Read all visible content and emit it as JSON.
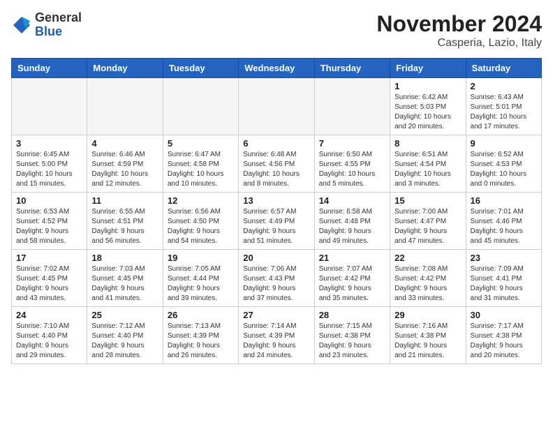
{
  "header": {
    "logo": {
      "general": "General",
      "blue": "Blue"
    },
    "title": "November 2024",
    "location": "Casperia, Lazio, Italy"
  },
  "weekdays": [
    "Sunday",
    "Monday",
    "Tuesday",
    "Wednesday",
    "Thursday",
    "Friday",
    "Saturday"
  ],
  "weeks": [
    [
      {
        "day": "",
        "info": ""
      },
      {
        "day": "",
        "info": ""
      },
      {
        "day": "",
        "info": ""
      },
      {
        "day": "",
        "info": ""
      },
      {
        "day": "",
        "info": ""
      },
      {
        "day": "1",
        "info": "Sunrise: 6:42 AM\nSunset: 5:03 PM\nDaylight: 10 hours\nand 20 minutes."
      },
      {
        "day": "2",
        "info": "Sunrise: 6:43 AM\nSunset: 5:01 PM\nDaylight: 10 hours\nand 17 minutes."
      }
    ],
    [
      {
        "day": "3",
        "info": "Sunrise: 6:45 AM\nSunset: 5:00 PM\nDaylight: 10 hours\nand 15 minutes."
      },
      {
        "day": "4",
        "info": "Sunrise: 6:46 AM\nSunset: 4:59 PM\nDaylight: 10 hours\nand 12 minutes."
      },
      {
        "day": "5",
        "info": "Sunrise: 6:47 AM\nSunset: 4:58 PM\nDaylight: 10 hours\nand 10 minutes."
      },
      {
        "day": "6",
        "info": "Sunrise: 6:48 AM\nSunset: 4:56 PM\nDaylight: 10 hours\nand 8 minutes."
      },
      {
        "day": "7",
        "info": "Sunrise: 6:50 AM\nSunset: 4:55 PM\nDaylight: 10 hours\nand 5 minutes."
      },
      {
        "day": "8",
        "info": "Sunrise: 6:51 AM\nSunset: 4:54 PM\nDaylight: 10 hours\nand 3 minutes."
      },
      {
        "day": "9",
        "info": "Sunrise: 6:52 AM\nSunset: 4:53 PM\nDaylight: 10 hours\nand 0 minutes."
      }
    ],
    [
      {
        "day": "10",
        "info": "Sunrise: 6:53 AM\nSunset: 4:52 PM\nDaylight: 9 hours\nand 58 minutes."
      },
      {
        "day": "11",
        "info": "Sunrise: 6:55 AM\nSunset: 4:51 PM\nDaylight: 9 hours\nand 56 minutes."
      },
      {
        "day": "12",
        "info": "Sunrise: 6:56 AM\nSunset: 4:50 PM\nDaylight: 9 hours\nand 54 minutes."
      },
      {
        "day": "13",
        "info": "Sunrise: 6:57 AM\nSunset: 4:49 PM\nDaylight: 9 hours\nand 51 minutes."
      },
      {
        "day": "14",
        "info": "Sunrise: 6:58 AM\nSunset: 4:48 PM\nDaylight: 9 hours\nand 49 minutes."
      },
      {
        "day": "15",
        "info": "Sunrise: 7:00 AM\nSunset: 4:47 PM\nDaylight: 9 hours\nand 47 minutes."
      },
      {
        "day": "16",
        "info": "Sunrise: 7:01 AM\nSunset: 4:46 PM\nDaylight: 9 hours\nand 45 minutes."
      }
    ],
    [
      {
        "day": "17",
        "info": "Sunrise: 7:02 AM\nSunset: 4:45 PM\nDaylight: 9 hours\nand 43 minutes."
      },
      {
        "day": "18",
        "info": "Sunrise: 7:03 AM\nSunset: 4:45 PM\nDaylight: 9 hours\nand 41 minutes."
      },
      {
        "day": "19",
        "info": "Sunrise: 7:05 AM\nSunset: 4:44 PM\nDaylight: 9 hours\nand 39 minutes."
      },
      {
        "day": "20",
        "info": "Sunrise: 7:06 AM\nSunset: 4:43 PM\nDaylight: 9 hours\nand 37 minutes."
      },
      {
        "day": "21",
        "info": "Sunrise: 7:07 AM\nSunset: 4:42 PM\nDaylight: 9 hours\nand 35 minutes."
      },
      {
        "day": "22",
        "info": "Sunrise: 7:08 AM\nSunset: 4:42 PM\nDaylight: 9 hours\nand 33 minutes."
      },
      {
        "day": "23",
        "info": "Sunrise: 7:09 AM\nSunset: 4:41 PM\nDaylight: 9 hours\nand 31 minutes."
      }
    ],
    [
      {
        "day": "24",
        "info": "Sunrise: 7:10 AM\nSunset: 4:40 PM\nDaylight: 9 hours\nand 29 minutes."
      },
      {
        "day": "25",
        "info": "Sunrise: 7:12 AM\nSunset: 4:40 PM\nDaylight: 9 hours\nand 28 minutes."
      },
      {
        "day": "26",
        "info": "Sunrise: 7:13 AM\nSunset: 4:39 PM\nDaylight: 9 hours\nand 26 minutes."
      },
      {
        "day": "27",
        "info": "Sunrise: 7:14 AM\nSunset: 4:39 PM\nDaylight: 9 hours\nand 24 minutes."
      },
      {
        "day": "28",
        "info": "Sunrise: 7:15 AM\nSunset: 4:38 PM\nDaylight: 9 hours\nand 23 minutes."
      },
      {
        "day": "29",
        "info": "Sunrise: 7:16 AM\nSunset: 4:38 PM\nDaylight: 9 hours\nand 21 minutes."
      },
      {
        "day": "30",
        "info": "Sunrise: 7:17 AM\nSunset: 4:38 PM\nDaylight: 9 hours\nand 20 minutes."
      }
    ]
  ]
}
